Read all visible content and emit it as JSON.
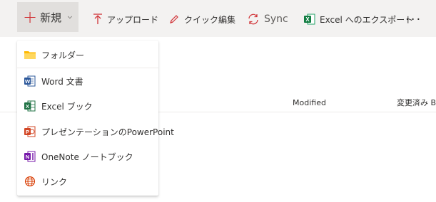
{
  "toolbar": {
    "new_label": "新規",
    "upload_label": "アップロード",
    "quick_edit_label": "クイック編集",
    "sync_label": "Sync",
    "export_label": "Excel へのエクスポート",
    "more_label": "···"
  },
  "columns": {
    "modified": "Modified",
    "modified_by": "変更済み B"
  },
  "new_menu": {
    "items": [
      {
        "label": "フォルダー",
        "icon": "folder-icon"
      },
      {
        "label": "Word 文書",
        "icon": "word-icon"
      },
      {
        "label": "Excel ブック",
        "icon": "excel-icon"
      },
      {
        "label": "プレゼンテーションのPowerPoint",
        "icon": "powerpoint-icon"
      },
      {
        "label": "OneNote ノートブック",
        "icon": "onenote-icon"
      },
      {
        "label": "リンク",
        "icon": "link-globe-icon"
      }
    ]
  },
  "colors": {
    "toolbar_bg": "#f3f2f1",
    "new_button_bg": "#e1dfdd",
    "accent_red": "#d13438",
    "word_blue": "#2b579a",
    "excel_green": "#217346",
    "powerpoint_orange": "#d24726",
    "onenote_purple": "#7719aa",
    "folder_yellow": "#ffb900",
    "globe_orange": "#d83b01"
  }
}
